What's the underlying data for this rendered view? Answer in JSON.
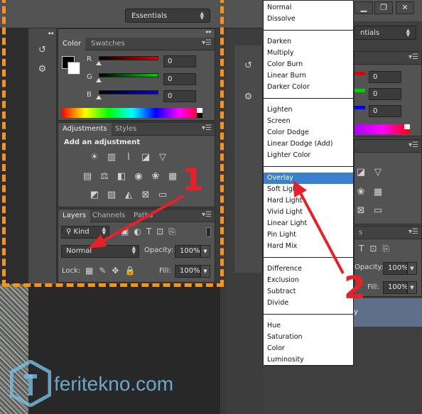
{
  "topbar": {
    "workspace_label": "Essentials",
    "collapse_glyph": "◂◂",
    "right_collapse_glyph": "▸▸"
  },
  "color_panel": {
    "tabs": [
      "Color",
      "Swatches"
    ],
    "channels": [
      {
        "label": "R",
        "value": "0"
      },
      {
        "label": "G",
        "value": "0"
      },
      {
        "label": "B",
        "value": "0"
      }
    ]
  },
  "adjustments_panel": {
    "tabs": [
      "Adjustments",
      "Styles"
    ],
    "heading": "Add an adjustment",
    "icons": [
      "brightness-icon",
      "levels-icon",
      "curves-icon",
      "exposure-icon",
      "vibrance-icon",
      "hue-saturation-icon",
      "color-balance-icon",
      "black-white-icon",
      "photo-filter-icon",
      "channel-mixer-icon",
      "color-lookup-icon",
      "invert-icon",
      "posterize-icon",
      "threshold-icon",
      "selective-color-icon",
      "gradient-map-icon"
    ]
  },
  "layers_panel": {
    "tabs": [
      "Layers",
      "Channels",
      "Paths"
    ],
    "filter_label": "Kind",
    "blend_mode": "Normal",
    "opacity_label": "Opacity:",
    "opacity_value": "100%",
    "lock_label": "Lock:",
    "fill_label": "Fill:",
    "fill_value": "100%"
  },
  "right_background": {
    "workspace_label": "ntials",
    "values": [
      "0",
      "0",
      "0"
    ],
    "layers_tab_suffix": "s",
    "opacity_label": "Opacity:",
    "opacity_value": "100%",
    "fill_label": "Fill:",
    "fill_value": "100%",
    "selected_layer_fragment": "y"
  },
  "blend_menu": {
    "groups": [
      [
        "Normal",
        "Dissolve"
      ],
      [
        "Darken",
        "Multiply",
        "Color Burn",
        "Linear Burn",
        "Darker Color"
      ],
      [
        "Lighten",
        "Screen",
        "Color Dodge",
        "Linear Dodge (Add)",
        "Lighter Color"
      ],
      [
        "Overlay",
        "Soft Light",
        "Hard Light",
        "Vivid Light",
        "Linear Light",
        "Pin Light",
        "Hard Mix"
      ],
      [
        "Difference",
        "Exclusion",
        "Subtract",
        "Divide"
      ],
      [
        "Hue",
        "Saturation",
        "Color",
        "Luminosity"
      ]
    ],
    "selected": "Overlay"
  },
  "annotations": {
    "step1": "1",
    "step2": "2"
  },
  "watermark": {
    "text": "feritekno.com"
  },
  "colors": {
    "highlight": "#f7941d",
    "annotation": "#e8202a",
    "selection": "#3c7fcf"
  }
}
